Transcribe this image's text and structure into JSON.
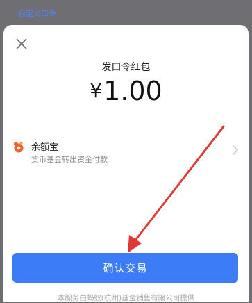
{
  "background": {
    "link_text": "自定义口令"
  },
  "sheet": {
    "title": "发口令红包",
    "amount": {
      "currency": "¥",
      "value": "1.00"
    },
    "payment_method": {
      "name": "余额宝",
      "description": "货币基金转出资金付款"
    },
    "confirm_label": "确认交易",
    "footer_text": "本服务由蚂蚁(杭州)基金销售有限公司提供"
  },
  "colors": {
    "accent": "#3d7cf7",
    "arrow": "#e0393a",
    "link": "#4d84ff"
  }
}
